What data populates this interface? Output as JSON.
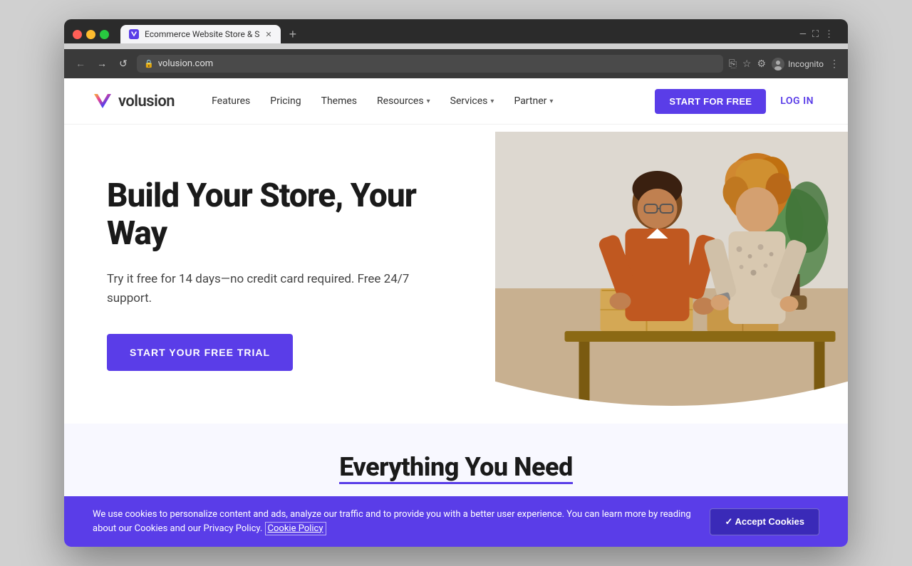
{
  "browser": {
    "tab_title": "Ecommerce Website Store & S",
    "url": "volusion.com",
    "incognito_label": "Incognito"
  },
  "nav": {
    "logo_text": "volusion",
    "links": [
      {
        "label": "Features",
        "has_dropdown": false
      },
      {
        "label": "Pricing",
        "has_dropdown": false
      },
      {
        "label": "Themes",
        "has_dropdown": false
      },
      {
        "label": "Resources",
        "has_dropdown": true
      },
      {
        "label": "Services",
        "has_dropdown": true
      },
      {
        "label": "Partner",
        "has_dropdown": true
      }
    ],
    "start_free_label": "START FOR FREE",
    "login_label": "LOG IN"
  },
  "hero": {
    "title": "Build Your Store, Your Way",
    "subtitle": "Try it free for 14 days—no credit card required. Free 24/7 support.",
    "cta_label": "START YOUR FREE TRIAL"
  },
  "section_teaser": {
    "title": "Everything You Need"
  },
  "cookie_banner": {
    "text": "We use cookies to personalize content and ads, analyze our traffic and to provide you with a better user experience. You can learn more by reading about our Cookies and our Privacy Policy.",
    "link_label": "Cookie Policy",
    "accept_label": "✓ Accept Cookies"
  }
}
